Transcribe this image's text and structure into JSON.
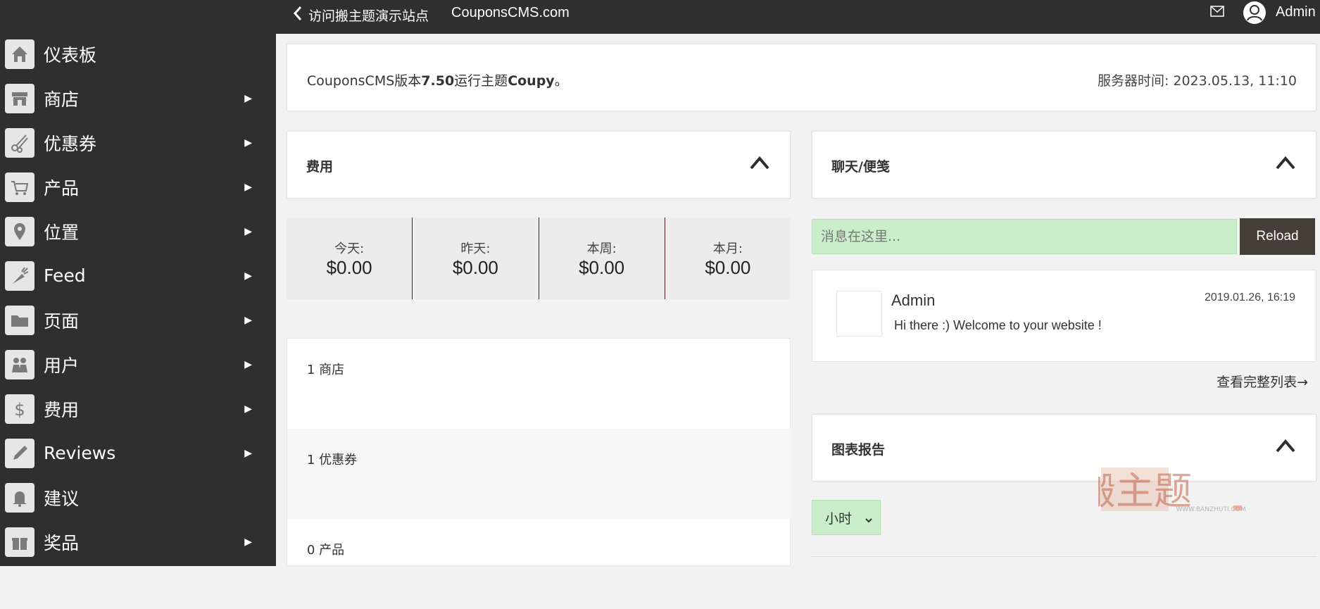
{
  "colors": {
    "sidebar_bg": "#2f2f2f",
    "topbar_bg": "#2f2f2f",
    "input_bg": "#c9eec9",
    "reload_bg": "#453e36",
    "divider": "#4a1f1f"
  },
  "topbar": {
    "visit_label": "访问搬主题演示站点",
    "site_name": "CouponsCMS.com",
    "user_name": "Admin"
  },
  "sidebar": {
    "items": [
      {
        "label": "仪表板",
        "icon": "home-icon",
        "has_submenu": false
      },
      {
        "label": "商店",
        "icon": "store-icon",
        "has_submenu": true
      },
      {
        "label": "优惠券",
        "icon": "scissors-icon",
        "has_submenu": true
      },
      {
        "label": "产品",
        "icon": "cart-icon",
        "has_submenu": true
      },
      {
        "label": "位置",
        "icon": "map-pin-icon",
        "has_submenu": true
      },
      {
        "label": "Feed",
        "icon": "carrot-icon",
        "has_submenu": true
      },
      {
        "label": "页面",
        "icon": "folder-icon",
        "has_submenu": true
      },
      {
        "label": "用户",
        "icon": "users-icon",
        "has_submenu": true
      },
      {
        "label": "费用",
        "icon": "dollar-icon",
        "has_submenu": true
      },
      {
        "label": "Reviews",
        "icon": "pencil-icon",
        "has_submenu": true
      },
      {
        "label": "建议",
        "icon": "bell-icon",
        "has_submenu": false
      },
      {
        "label": "奖品",
        "icon": "gift-icon",
        "has_submenu": true
      }
    ]
  },
  "version_bar": {
    "prefix": "CouponsCMS版本",
    "version": "7.50",
    "middle": "运行主题",
    "theme": "Coupy",
    "suffix": "。",
    "server_time": "服务器时间: 2023.05.13, 11:10"
  },
  "fees_panel": {
    "title": "费用",
    "stats": [
      {
        "label": "今天:",
        "value": "$0.00"
      },
      {
        "label": "昨天:",
        "value": "$0.00"
      },
      {
        "label": "本周:",
        "value": "$0.00"
      },
      {
        "label": "本月:",
        "value": "$0.00"
      }
    ]
  },
  "counts": [
    {
      "text": "1 商店"
    },
    {
      "text": "1 优惠券"
    },
    {
      "text": "0 产品"
    }
  ],
  "chat_panel": {
    "title": "聊天/便笺",
    "input_placeholder": "消息在这里...",
    "reload_label": "Reload",
    "message": {
      "author": "Admin",
      "date": "2019.01.26, 16:19",
      "text": "Hi there :) Welcome to your website !"
    },
    "view_all": "查看完整列表→"
  },
  "chart_panel": {
    "title": "图表报告",
    "range_selected": "小时"
  },
  "watermark": {
    "text": "搬主题",
    "url": "WWW.BANZHUTI.COM"
  }
}
